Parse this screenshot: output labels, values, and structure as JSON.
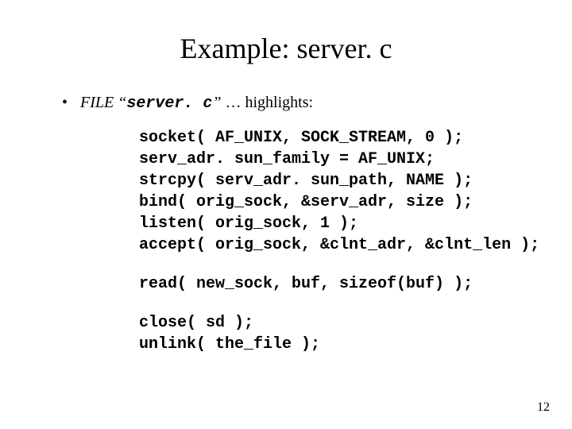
{
  "title": "Example: server. c",
  "bullet": {
    "file_label": "FILE",
    "open_quote": "“",
    "filename": "server. c",
    "close_quote": "”",
    "rest": " … highlights:"
  },
  "code": {
    "block1": "socket( AF_UNIX, SOCK_STREAM, 0 );\nserv_adr. sun_family = AF_UNIX;\nstrcpy( serv_adr. sun_path, NAME );\nbind( orig_sock, &serv_adr, size );\nlisten( orig_sock, 1 );\naccept( orig_sock, &clnt_adr, &clnt_len );",
    "block2": "read( new_sock, buf, sizeof(buf) );",
    "block3": "close( sd );\nunlink( the_file );"
  },
  "page_number": "12"
}
